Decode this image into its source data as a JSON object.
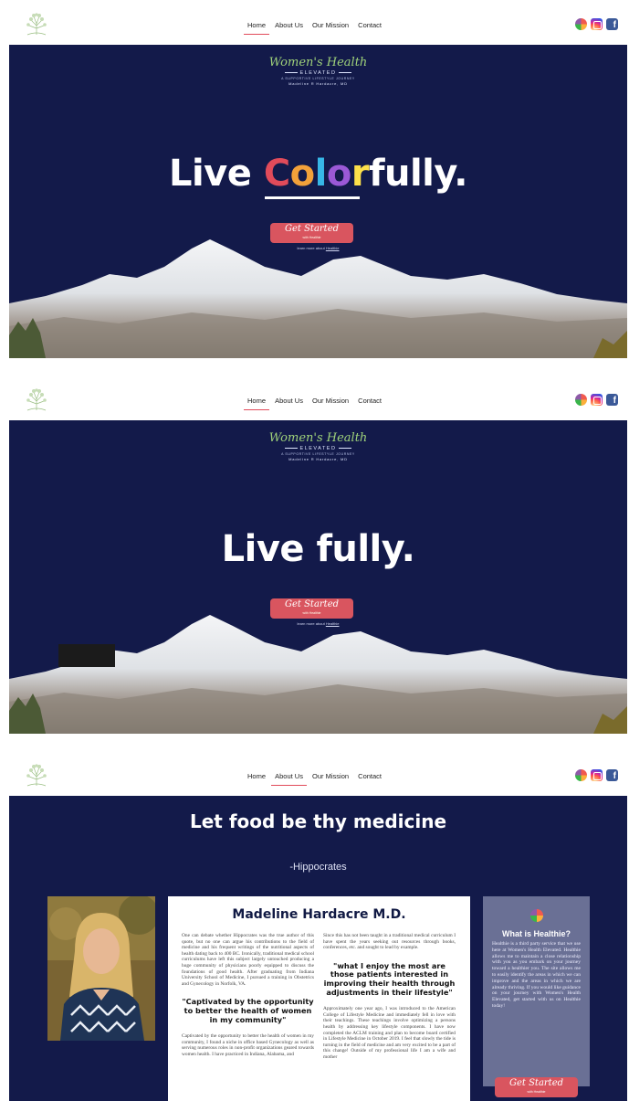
{
  "nav": {
    "items": [
      "Home",
      "About Us",
      "Our Mission",
      "Contact"
    ]
  },
  "brand": {
    "script": "Women's Health",
    "elevated": "ELEVATED",
    "tagline": "A SUPPORTIVE LIFESTYLE JOURNEY",
    "name": "Madeline R Hardacre, MD"
  },
  "hero1": {
    "headline_pre": "Live ",
    "headline_color": [
      "C",
      "o",
      "l",
      "o",
      "r"
    ],
    "headline_post": "fully."
  },
  "hero2": {
    "headline": "Live fully."
  },
  "cta": {
    "label": "Get Started",
    "sub": "with Healthie",
    "learn_prefix": "learn more about ",
    "learn_link": "Healthie"
  },
  "about": {
    "quote": "Let food be thy medicine",
    "author": "-Hippocrates",
    "bio_title": "Madeline Hardacre M.D.",
    "col1_p1": "One can debate whether Hippocrates was the true author of this quote, but no one can argue his contributions to the field of medicine and his frequent writings of the nutritional aspects of health dating back to 400 BC. Ironically, traditional medical school curriculums have left this subject largely untouched producing a huge community of physicians poorly equipped to discuss the foundations of good health. After graduating from Indiana University School of Medicine, I pursued a training in Obstetrics and Gynecology in Norfolk, VA.",
    "col1_h": "\"Captivated by the opportunity to better the health of women in my community\"",
    "col1_p2": "Captivated by the opportunity to better the health of women in my community, I found a niche in office based Gynecology as well as serving numerous roles in non-profit organizations geared towards women health. I have practiced in Indiana, Alabama, and",
    "col2_p1": "Since this has not been taught in a traditional medical curriculum I have spent the years seeking out resources through books, conferences, etc. and sought to lead by example.",
    "col2_h": "\"what I enjoy the most are those patients interested in improving their health through adjustments in their lifestyle\"",
    "col2_p2": "Approximately one year ago, I was introduced to the American College of Lifestyle Medicine and immediately fell in love with their teachings. These teachings involve optimizing a persons health by addressing key lifestyle components. I have now completed the ACLM training and plan to become board certified in Lifestyle Medicine in October 2019. I feel that slowly the tide is turning in the field of medicine and am very excited to be a part of this change! Outside of my professional life I am a wife and mother",
    "healthie_title": "What is Healthie?",
    "healthie_text": "Healthie is a third party service that we use here at Women's Health Elevated. Healthie allows me to maintain a close relationship with you as you embark on your journey toward a healthier you. The site allows me to easily identify the areas in which we can improve and the areas in which we are already thriving. If you would like guidance on your journey with Women's Health Elevated, get started with us on Healthie today!"
  },
  "colors": {
    "navy": "#131a4a",
    "accent": "#d9555f",
    "healthie_panel": "#6a7095"
  },
  "icons": [
    "tree-logo-icon",
    "healthie-icon",
    "instagram-icon",
    "facebook-icon"
  ]
}
